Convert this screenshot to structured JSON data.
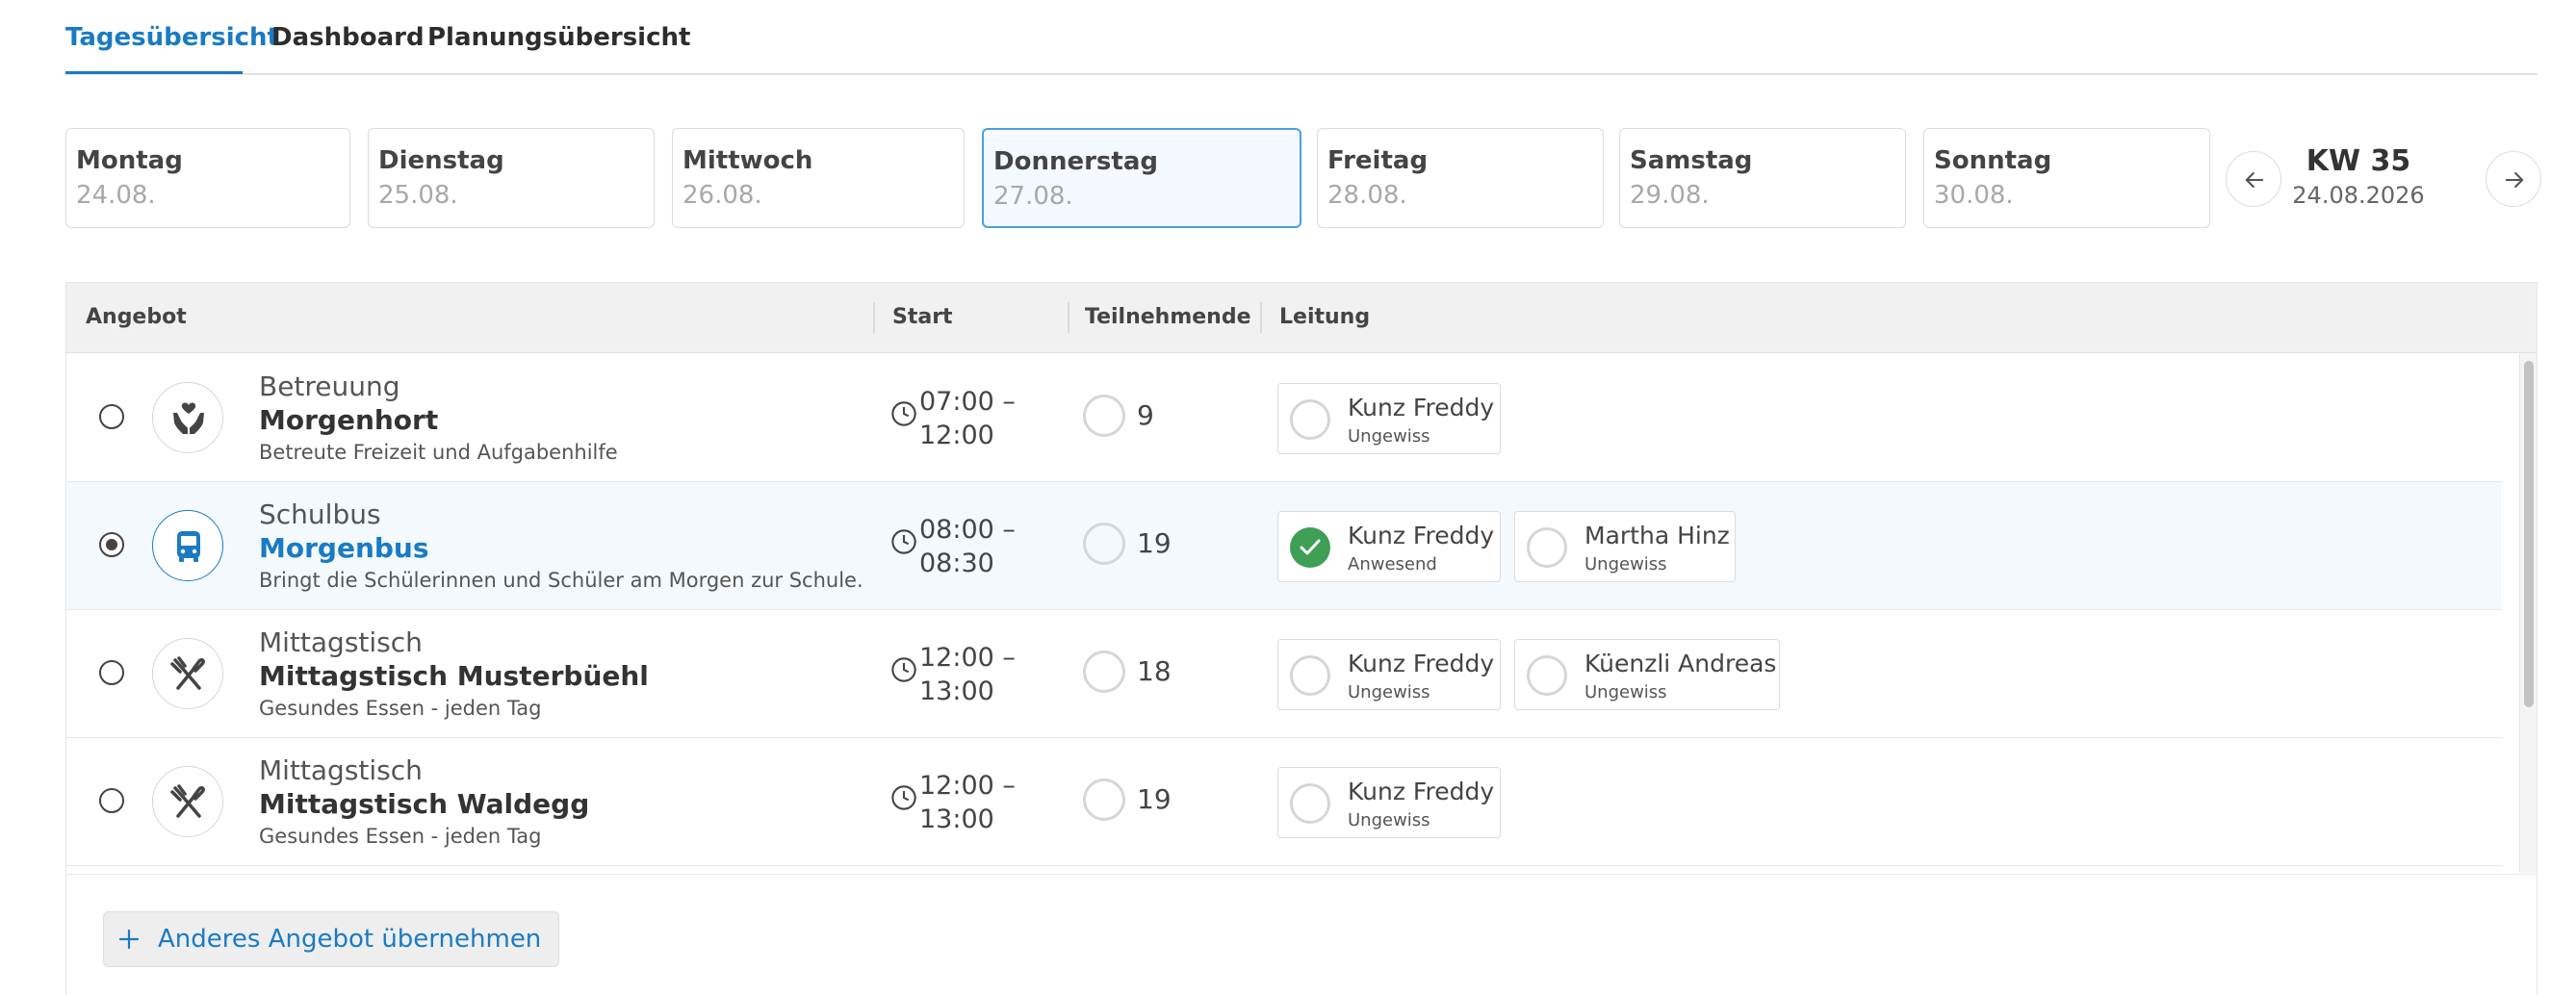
{
  "tabs": [
    {
      "label": "Tagesübersicht",
      "active": true
    },
    {
      "label": "Dashboard",
      "active": false
    },
    {
      "label": "Planungsübersicht",
      "active": false
    }
  ],
  "days": [
    {
      "name": "Montag",
      "date": "24.08."
    },
    {
      "name": "Dienstag",
      "date": "25.08."
    },
    {
      "name": "Mittwoch",
      "date": "26.08."
    },
    {
      "name": "Donnerstag",
      "date": "27.08.",
      "active": true
    },
    {
      "name": "Freitag",
      "date": "28.08."
    },
    {
      "name": "Samstag",
      "date": "29.08."
    },
    {
      "name": "Sonntag",
      "date": "30.08."
    }
  ],
  "week": {
    "label": "KW 35",
    "date": "24.08.2026"
  },
  "table": {
    "headers": {
      "angebot": "Angebot",
      "start": "Start",
      "teilnehmende": "Teilnehmende",
      "leitung": "Leitung"
    },
    "rows": [
      {
        "category": "Betreuung",
        "title": "Morgenhort",
        "description": "Betreute Freizeit und Aufgabenhilfe",
        "icon": "care-hands-icon",
        "time_start": "07:00 –",
        "time_end": "12:00",
        "participants": "9",
        "leaders": [
          {
            "name": "Kunz Freddy",
            "status": "Ungewiss"
          }
        ]
      },
      {
        "category": "Schulbus",
        "title": "Morgenbus",
        "description": "Bringt die Schülerinnen und Schüler am Morgen zur Schule.",
        "icon": "bus-icon",
        "selected": true,
        "time_start": "08:00 –",
        "time_end": "08:30",
        "participants": "19",
        "leaders": [
          {
            "name": "Kunz Freddy",
            "status": "Anwesend"
          },
          {
            "name": "Martha Hinz",
            "status": "Ungewiss"
          }
        ]
      },
      {
        "category": "Mittagstisch",
        "title": "Mittagstisch Musterbüehl",
        "description": "Gesundes Essen - jeden Tag",
        "icon": "utensils-icon",
        "time_start": "12:00 –",
        "time_end": "13:00",
        "participants": "18",
        "leaders": [
          {
            "name": "Kunz Freddy",
            "status": "Ungewiss"
          },
          {
            "name": "Küenzli Andreas",
            "status": "Ungewiss"
          }
        ]
      },
      {
        "category": "Mittagstisch",
        "title": "Mittagstisch Waldegg",
        "description": "Gesundes Essen - jeden Tag",
        "icon": "utensils-icon",
        "time_start": "12:00 –",
        "time_end": "13:00",
        "participants": "19",
        "leaders": [
          {
            "name": "Kunz Freddy",
            "status": "Ungewiss"
          }
        ]
      }
    ]
  },
  "actions": {
    "add_offer": "Anderes Angebot übernehmen"
  },
  "colors": {
    "accent": "#1a7bc4",
    "success": "#3f9f55",
    "header_bg": "#f1f1f1",
    "selected_row": "#f4f9fd"
  }
}
